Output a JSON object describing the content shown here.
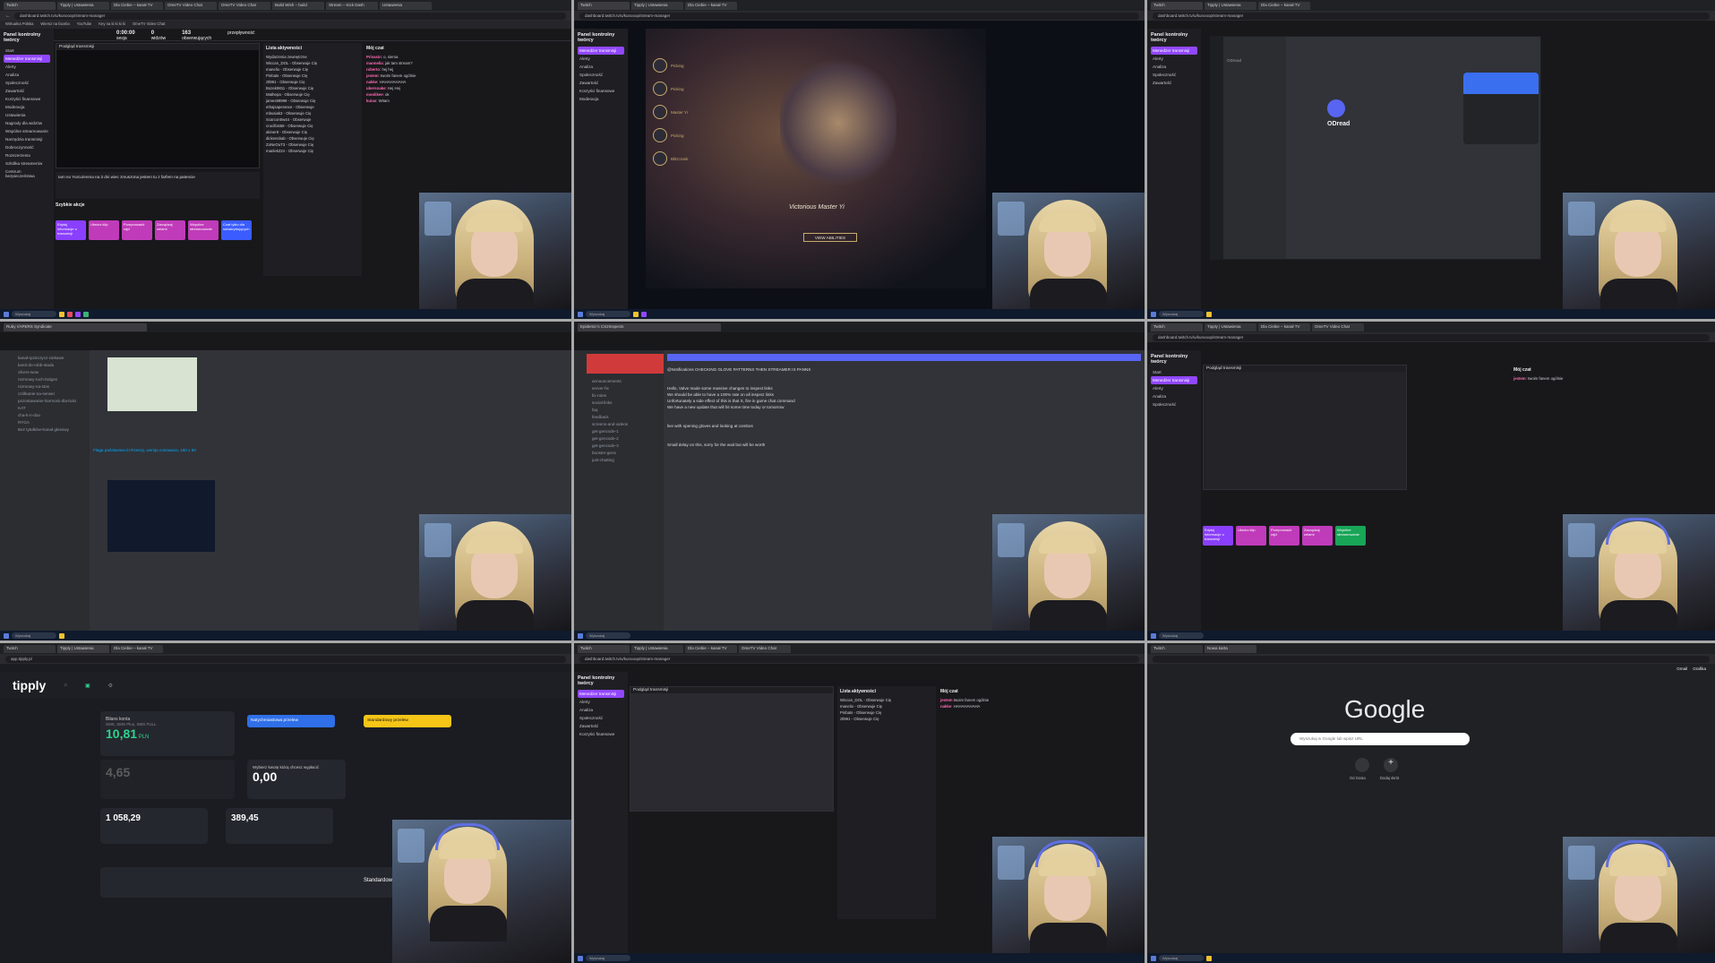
{
  "common": {
    "tabs": [
      "Twitch",
      "Tipply | Ustawienia",
      "Dla Ciebie – kanał TV",
      "OmeTV Video Chat",
      "OmeTV Video Chat",
      "Build Wish – build",
      "Stream – Kick Dash",
      "Ustawienia"
    ],
    "url_manager": "dashboard.twitch.tv/u/kunooop/stream-manager",
    "bookmarks": [
      "Wirtualna Polska",
      "Wiersz na facebo",
      "YouTube",
      "Key na ki ki ki ki",
      "OmeTV Video Chat"
    ],
    "taskbar_search": "Wyszukaj"
  },
  "manager": {
    "title": "Panel kontrolny twórcy",
    "sidebar": [
      "Start",
      "Menedżer transmisji",
      "Alerty",
      "Analiza",
      "Społeczność",
      "Zawartość",
      "Korzyści finansowe",
      "Moderacja",
      "Ustawienia",
      "Nagrody dla widzów",
      "Wspólne streamowanie",
      "Narzędzia transmisji",
      "Dobroczynność",
      "Rozszerzenia",
      "Szkółka streamerów",
      "Centrum bezpieczeństwa"
    ],
    "stats": [
      {
        "v": "0:00:00",
        "l": "sesja"
      },
      {
        "v": "0",
        "l": "widzów"
      },
      {
        "v": "163",
        "l": "obserwujących"
      },
      {
        "v": "",
        "l": "przepływność"
      }
    ],
    "preview_title": "Podgląd transmisji",
    "activity_title": "Lista aktywności",
    "activity": [
      "Wydarzenia zewnętrzne",
      "Wiccan_DOL - Obserwuje Cię",
      "manelio - Obserwuje Cię",
      "Pinbats - Obserwuje Cię",
      "ztl991 - Obserwuje Cię",
      "Bozek9811 - Obserwuje Cię",
      "Mathepa - Obserwuje Cię",
      "james99999 - Obserwuje Cię",
      "ethajsaperance - Obserwuje",
      "mbusiak3 - Obserwuje Cię",
      "Scarcon0w44 - Obserwuje",
      "crucifix558 - Obserwuje Cię",
      "akiner8 - Obserwuje Cię",
      "dickensbab - Obserwuje Cię",
      "ZoNeOuT3 - Obserwuje Cię",
      "manlek224 - Obserwuje Cię"
    ],
    "chat_title": "Mój czat",
    "chat": [
      [
        "Privasin",
        "o, siema"
      ],
      [
        "mannelia",
        "jak tam stream?"
      ],
      [
        "roberto",
        "hej hej"
      ],
      [
        "jestem",
        "twoim fanem ogólnie"
      ],
      [
        "nakke",
        "HAHAHAHAHA"
      ],
      [
        "ubersnake",
        "Hej Hej"
      ],
      [
        "moolikee",
        "ok"
      ],
      [
        "kutas",
        "Witam"
      ]
    ],
    "quick_title": "Szybkie akcje",
    "quick": [
      "Edytuj informacje o transmisji",
      "Utwórz klip",
      "Przeprowadź rajd",
      "Zarządzaj celami",
      "Wspólne streamowanie",
      "Czat tylko dla subskrybujących"
    ],
    "stream_title": "Iam no Yurcu/enma na 3 dni wiec zmuszona jestem tu z farfem na patencie"
  },
  "game": {
    "title": "Victorious Master Yi",
    "button": "VIEW ABILITIES",
    "champs": [
      "Picking",
      "Picking",
      "Master Yi",
      "Picking",
      "Blitzcrank"
    ]
  },
  "discord1": {
    "server": "Ruby r/APERS Syndicate",
    "channels": [
      "kanał-rpzincrycz-ciekawe",
      "karol-do-robb-stada",
      "ofcers-wow",
      "rozmowy-ruch-bolgos",
      "rozmowy-na-stos",
      "czółkanie-na-serwer",
      "pozostawanie-harmonii-dla-bolo",
      "KAT",
      "cha-h-n-doa",
      "RYGA",
      "Bez tytułków-Kanał głosowy"
    ],
    "message": "Flaga państwowa III Rzeszy, wersja cosowana, 160 x 90"
  },
  "discord2": {
    "server": "Epidemic's CS2Inspects",
    "channels": [
      "announcements",
      "server-fix",
      "fix-rules",
      "social-links",
      "faq",
      "feedback",
      "screens-and-videos",
      "get-gencode-1",
      "get-gencode-2",
      "get-gencode-3",
      "booster-gens",
      "just-chatting"
    ],
    "messages": [
      "@Notifications CHECKING GLOVE PATTERNS THEN STREAMER IS PANNS",
      "Hello, Valve made some massive changes to inspect links",
      "We should be able to have a 100% rate on all inspect links",
      "Unfortunately a side effect of this is that S, fire in game chat command",
      "We have a new update that will hit some time today or tomorrow",
      "live with opening gloves and looking at combos",
      "Small delay on this, sorry for the wait but will be worth"
    ]
  },
  "tipply": {
    "logo": "tipply",
    "balance_label": "Bilans konta",
    "balance_sub": "SMS, SMS Plus, SMS FULL",
    "balance": "10,81",
    "currency": "PLN",
    "pending": "4,65",
    "withdraw_label": "Wybierz kwotę którą chcesz wypłacić",
    "withdraw": "0,00",
    "btn_inst": "Natychmiastowa przelew",
    "btn_std": "Standardowy przelew",
    "stat1": "1 058,29",
    "stat2": "389,45",
    "footer": "Standardowy p"
  },
  "google": {
    "logo": "Google",
    "search_placeholder": "Wyszukaj w Google lub wpisz URL",
    "shortcut1": "Od Gosia",
    "shortcut2": "Dodaj skrót",
    "links": [
      "Gmail",
      "Grafika"
    ]
  }
}
